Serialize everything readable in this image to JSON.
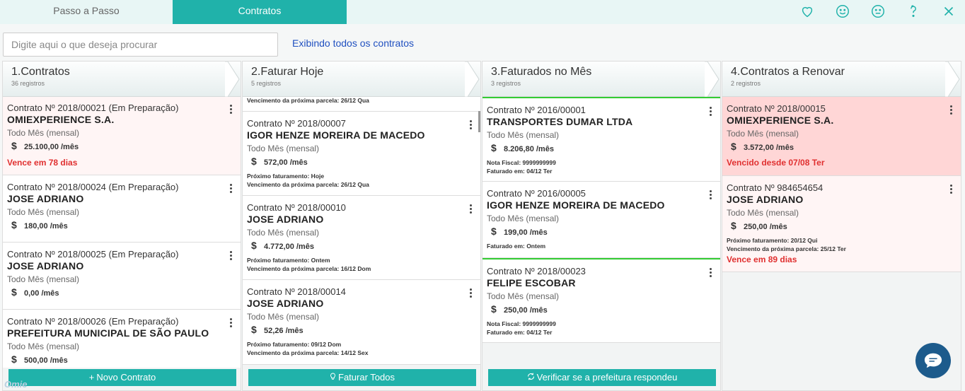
{
  "tabs": [
    {
      "label": "Passo a Passo",
      "active": false
    },
    {
      "label": "Contratos",
      "active": true
    }
  ],
  "top_icons": [
    "heart-icon",
    "smile-icon",
    "neutral-face-icon",
    "help-icon",
    "close-icon"
  ],
  "search": {
    "placeholder": "Digite aqui o que deseja procurar",
    "value": ""
  },
  "show_all_link": "Exibindo todos os contratos",
  "colors": {
    "accent": "#20b2aa",
    "alert": "#e03030",
    "link": "#2050c0",
    "green_border": "#33cc33",
    "overdue_bg": "#ffd6d6"
  },
  "columns": [
    {
      "title": "1.Contratos",
      "count": "36 registros",
      "footer": "Novo Contrato",
      "footer_icon": "plus-icon",
      "cards": [
        {
          "number": "Contrato Nº 2018/00021 (Em Preparação)",
          "name": "OMIEXPERIENCE S.A.",
          "period": "Todo Mês (mensal)",
          "value": "25.100,00 /mês",
          "alert": "Vence em 78 dias"
        },
        {
          "number": "Contrato Nº 2018/00024 (Em Preparação)",
          "name": "JOSE ADRIANO",
          "period": "Todo Mês (mensal)",
          "value": "180,00 /mês"
        },
        {
          "number": "Contrato Nº 2018/00025 (Em Preparação)",
          "name": "JOSE ADRIANO",
          "period": "Todo Mês (mensal)",
          "value": "0,00 /mês"
        },
        {
          "number": "Contrato Nº 2018/00026 (Em Preparação)",
          "name": "PREFEITURA MUNICIPAL DE SÃO PAULO",
          "period": "Todo Mês (mensal)",
          "value": "500,00 /mês"
        }
      ]
    },
    {
      "title": "2.Faturar Hoje",
      "count": "5 registros",
      "footer": "Faturar Todos",
      "footer_icon": "lightbulb-icon",
      "top_partial": "Vencimento da próxima parcela: 26/12 Qua",
      "cards": [
        {
          "number": "Contrato Nº 2018/00007",
          "name": "IGOR HENZE MOREIRA DE MACEDO",
          "period": "Todo Mês (mensal)",
          "value": "572,00 /mês",
          "line1": "Próximo faturamento: Hoje",
          "line2": "Vencimento da próxima parcela: 26/12 Qua"
        },
        {
          "number": "Contrato Nº 2018/00010",
          "name": "JOSE ADRIANO",
          "period": "Todo Mês (mensal)",
          "value": "4.772,00 /mês",
          "line1": "Próximo faturamento: Ontem",
          "line2": "Vencimento da próxima parcela: 16/12 Dom"
        },
        {
          "number": "Contrato Nº 2018/00014",
          "name": "JOSE ADRIANO",
          "period": "Todo Mês (mensal)",
          "value": "52,26 /mês",
          "line1": "Próximo faturamento: 09/12 Dom",
          "line2": "Vencimento da próxima parcela: 14/12 Sex"
        }
      ]
    },
    {
      "title": "3.Faturados no Mês",
      "count": "3 registros",
      "footer": "Verificar se a prefeitura respondeu",
      "footer_icon": "refresh-icon",
      "cards": [
        {
          "number": "Contrato Nº 2016/00001",
          "name": "TRANSPORTES DUMAR LTDA",
          "period": "Todo Mês (mensal)",
          "value": "8.206,80 /mês",
          "line1": "Nota Fiscal: 9999999999",
          "line2": "Faturado em: 04/12 Ter"
        },
        {
          "number": "Contrato Nº 2016/00005",
          "name": "IGOR HENZE MOREIRA DE MACEDO",
          "period": "Todo Mês (mensal)",
          "value": "199,00 /mês",
          "line1": "Faturado em: Ontem"
        },
        {
          "number": "Contrato Nº 2018/00023",
          "name": "FELIPE ESCOBAR",
          "period": "Todo Mês (mensal)",
          "value": "250,00 /mês",
          "line1": "Nota Fiscal: 9999999999",
          "line2": "Faturado em: 04/12 Ter"
        }
      ]
    },
    {
      "title": "4.Contratos a Renovar",
      "count": "2 registros",
      "cards": [
        {
          "number": "Contrato Nº 2018/00015",
          "name": "OMIEXPERIENCE S.A.",
          "period": "Todo Mês (mensal)",
          "value": "3.572,00 /mês",
          "alert": "Vencido desde 07/08 Ter"
        },
        {
          "number": "Contrato Nº 984654654",
          "name": "JOSE ADRIANO",
          "period": "Todo Mês (mensal)",
          "value": "250,00 /mês",
          "line1": "Próximo faturamento: 20/12 Qui",
          "line2": "Vencimento da próxima parcela: 25/12 Ter",
          "alert": "Vence em 89 dias"
        }
      ]
    }
  ],
  "currency_symbol": "$",
  "logo_text": "Omie"
}
